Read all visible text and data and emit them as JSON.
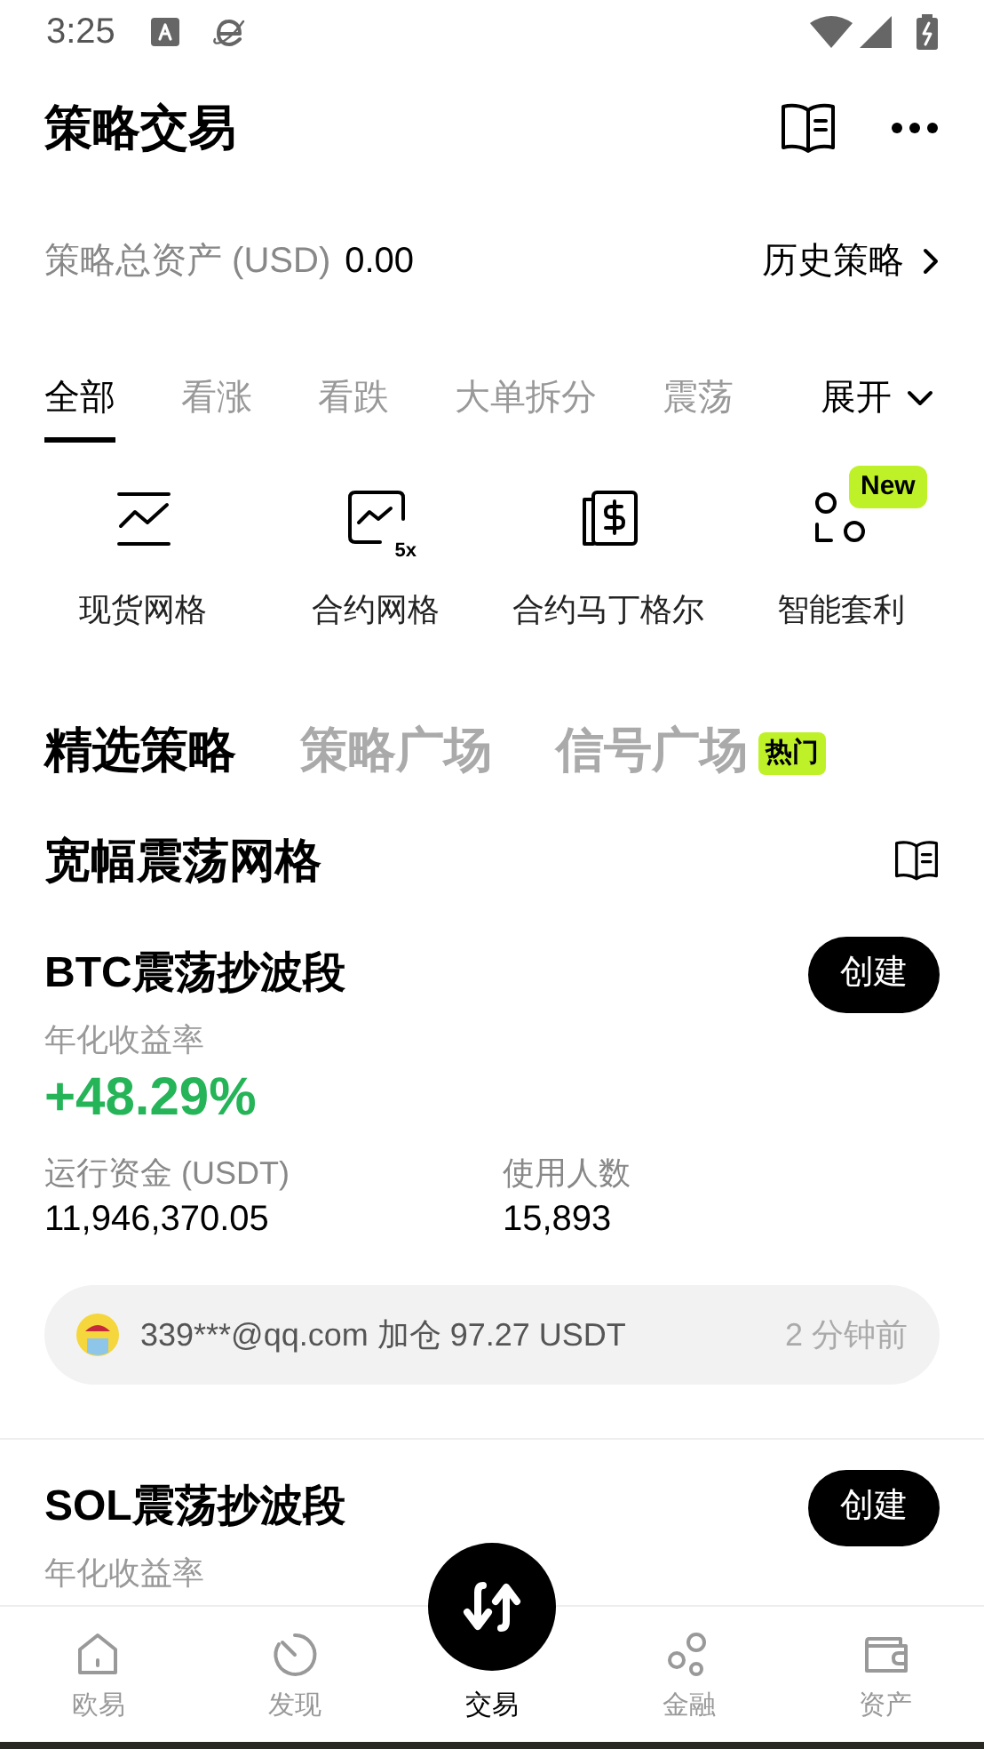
{
  "status_bar": {
    "time": "3:25"
  },
  "header": {
    "title": "策略交易"
  },
  "assets": {
    "label": "策略总资产 (USD)",
    "value": "0.00",
    "history_link": "历史策略"
  },
  "category_tabs": [
    {
      "label": "全部",
      "selected": true
    },
    {
      "label": "看涨",
      "selected": false
    },
    {
      "label": "看跌",
      "selected": false
    },
    {
      "label": "大单拆分",
      "selected": false
    },
    {
      "label": "震荡",
      "selected": false
    }
  ],
  "expand_button": "展开",
  "strategy_types": [
    {
      "kind": "spot-grid",
      "label": "现货网格"
    },
    {
      "kind": "futures-grid",
      "label": "合约网格",
      "icon_text": "5x"
    },
    {
      "kind": "martingale",
      "label": "合约马丁格尔"
    },
    {
      "kind": "arbitrage",
      "label": "智能套利",
      "badge": "New"
    }
  ],
  "section_tabs": [
    {
      "label": "精选策略",
      "selected": true
    },
    {
      "label": "策略广场",
      "selected": false
    },
    {
      "label": "信号广场",
      "selected": false,
      "badge": "热门"
    }
  ],
  "group_title": "宽幅震荡网格",
  "strategies": [
    {
      "name": "BTC震荡抄波段",
      "button": "创建",
      "yield_label": "年化收益率",
      "yield": "+48.29%",
      "funds_label": "运行资金 (USDT)",
      "funds": "11,946,370.05",
      "users_label": "使用人数",
      "users": "15,893",
      "activity": {
        "text": "339***@qq.com 加仓 97.27 USDT",
        "time": "2 分钟前"
      }
    },
    {
      "name": "SOL震荡抄波段",
      "button": "创建",
      "yield_label": "年化收益率"
    }
  ],
  "bottom_nav": [
    {
      "kind": "home",
      "label": "欧易",
      "selected": false
    },
    {
      "kind": "discover",
      "label": "发现",
      "selected": false
    },
    {
      "kind": "trade",
      "label": "交易",
      "selected": true
    },
    {
      "kind": "finance",
      "label": "金融",
      "selected": false
    },
    {
      "kind": "assets",
      "label": "资产",
      "selected": false
    }
  ]
}
